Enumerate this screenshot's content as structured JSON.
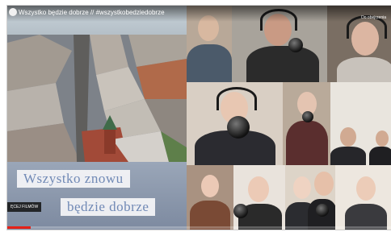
{
  "video": {
    "title": "Wszystko będzie dobrze // #wszystkobedziedobrze",
    "watch_later": "Do obejrzenia",
    "caption_line1": "Wszystko znowu",
    "caption_line2": "będzie dobrze",
    "more_videos": "ĘCEJ FILMÓW",
    "progress": 0.06
  },
  "colors": {
    "accent": "#e62117",
    "caption_text": "#7089b5"
  }
}
